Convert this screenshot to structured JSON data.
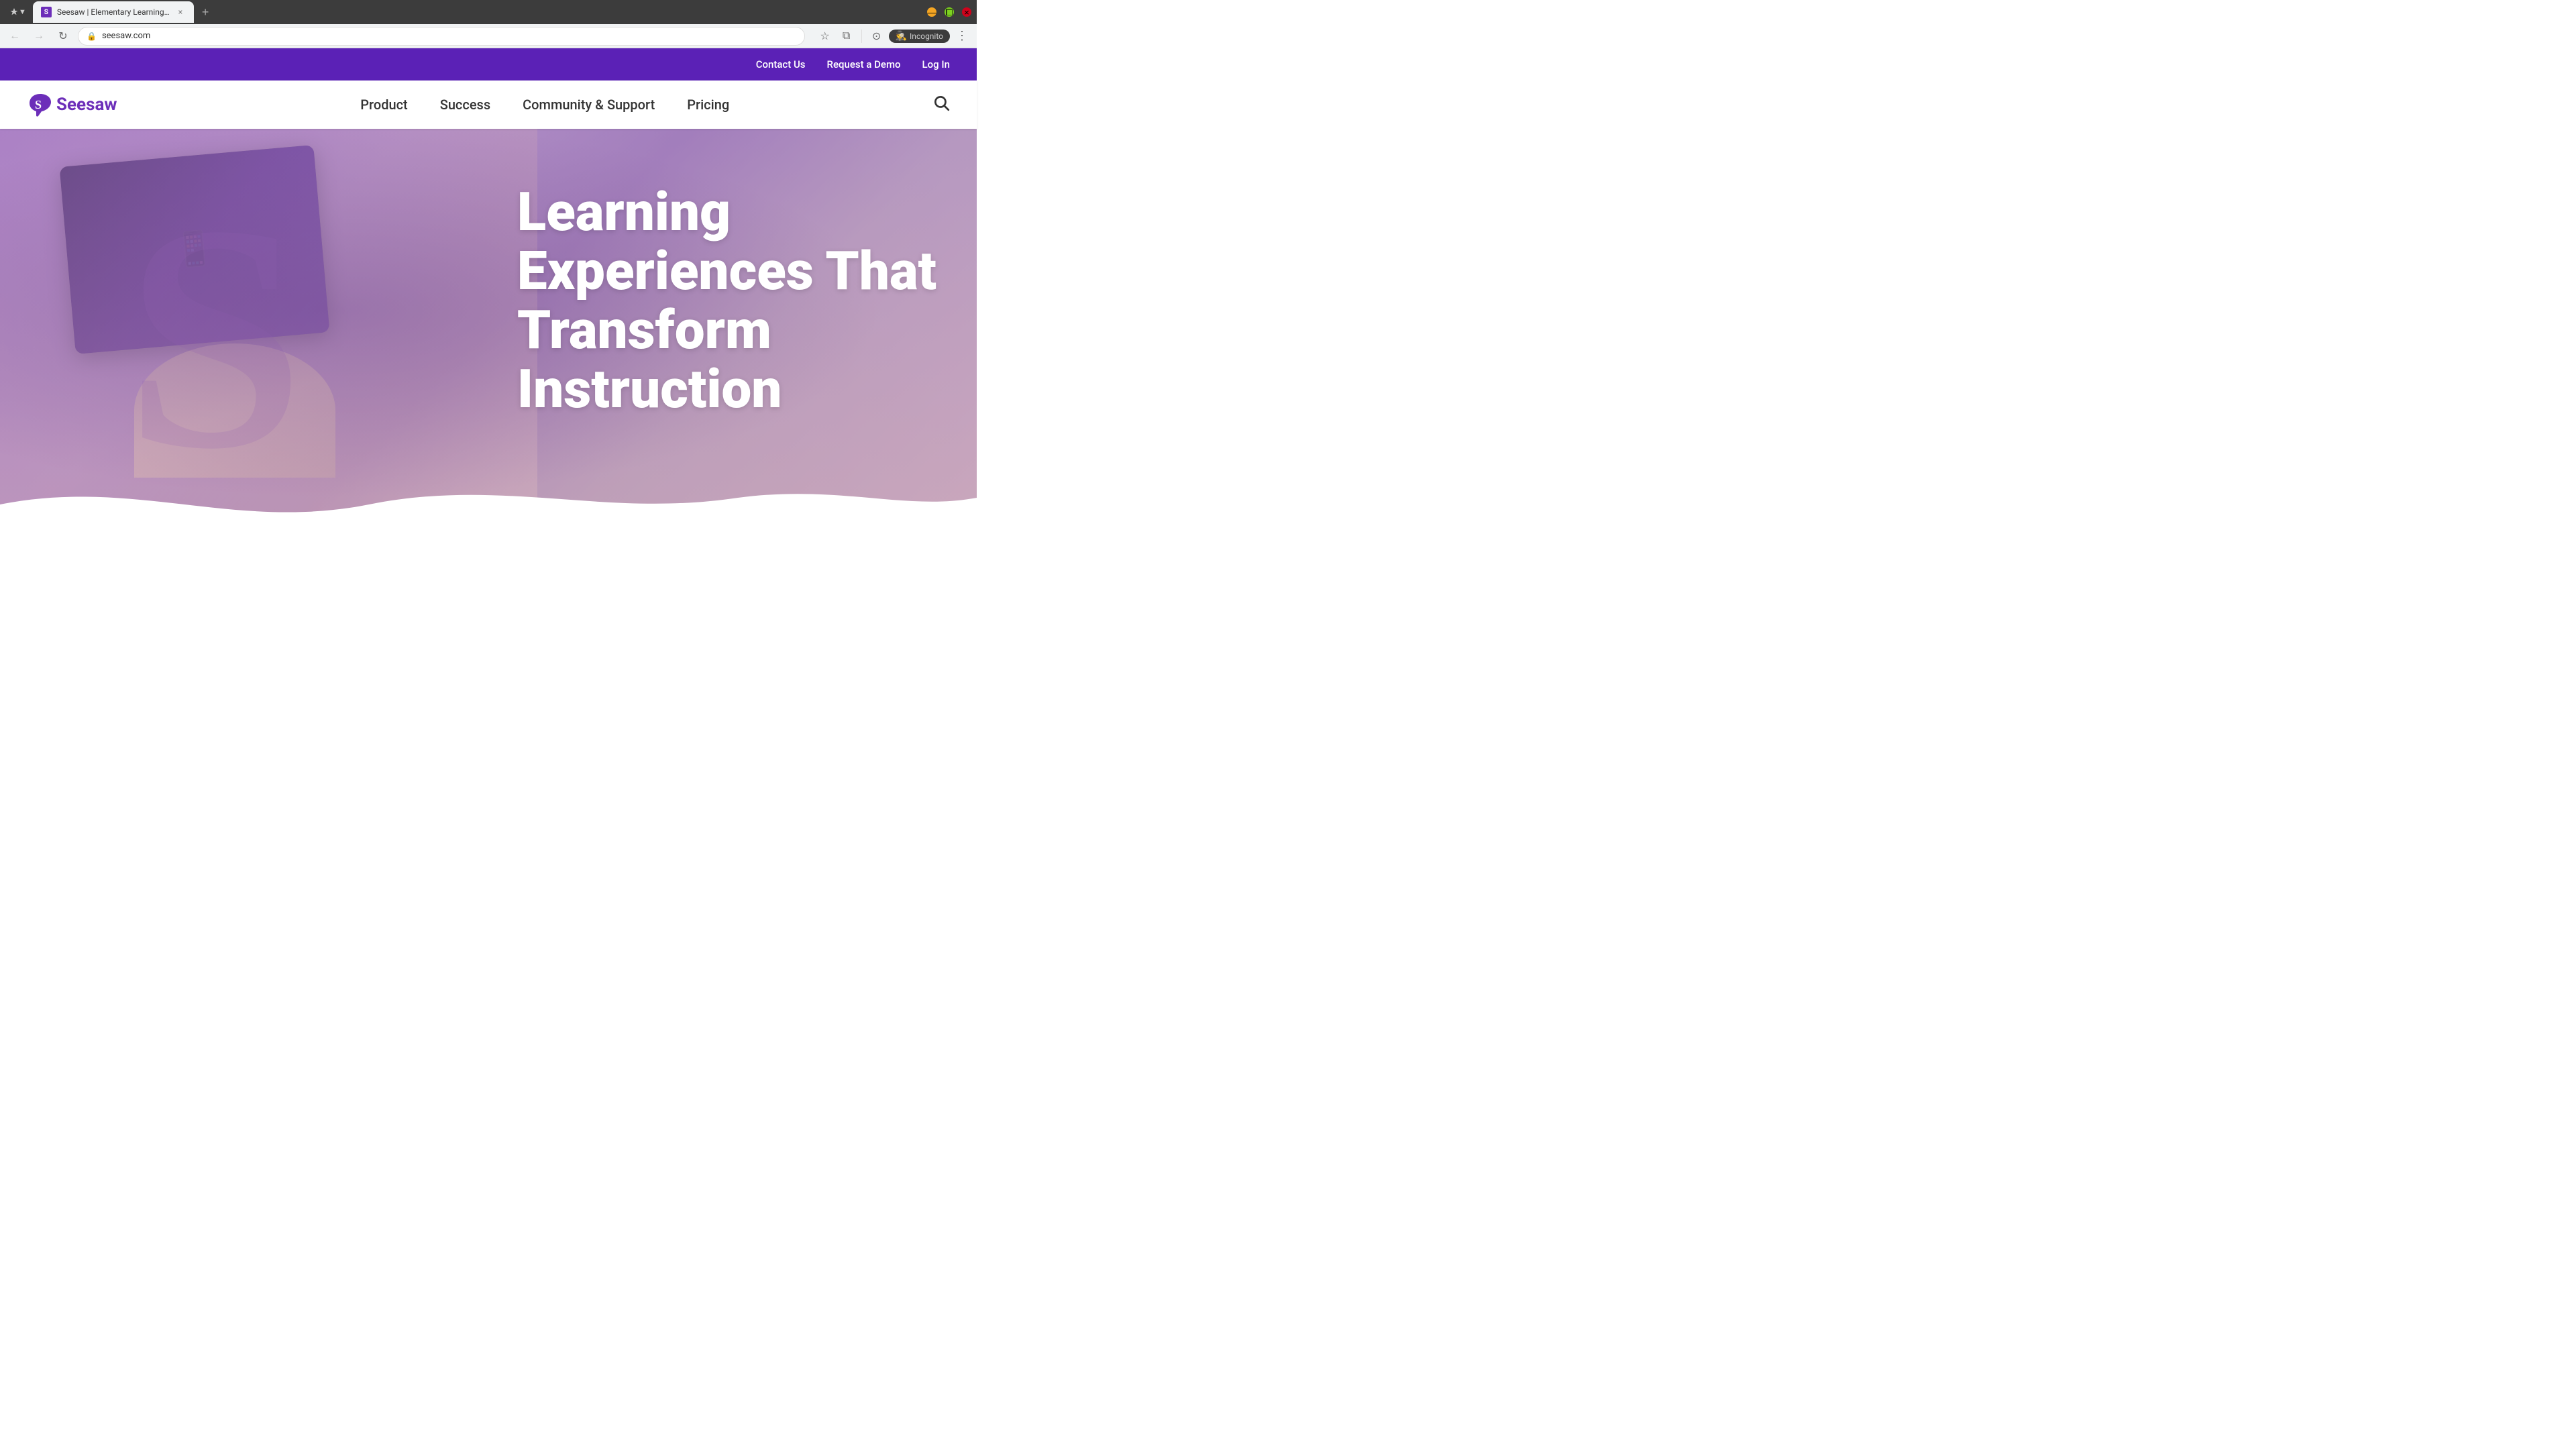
{
  "browser": {
    "tab_favicon": "S",
    "tab_title": "Seesaw | Elementary Learning ...",
    "tab_close_label": "×",
    "new_tab_label": "+",
    "nav_back_label": "←",
    "nav_forward_label": "→",
    "nav_reload_label": "↻",
    "url": "seesaw.com",
    "bookmark_label": "☆",
    "extensions_label": "⧉",
    "profile_label": "⊙",
    "incognito_label": "Incognito",
    "more_label": "⋮",
    "window_controls": {
      "minimize": "—",
      "maximize": "⧠",
      "close": "×"
    }
  },
  "site": {
    "top_bar": {
      "contact_us": "Contact Us",
      "request_demo": "Request a Demo",
      "log_in": "Log In"
    },
    "nav": {
      "logo_text": "Seesaw",
      "product": "Product",
      "success": "Success",
      "community_support": "Community & Support",
      "pricing": "Pricing"
    },
    "hero": {
      "title_line1": "Learning",
      "title_line2": "Experiences That",
      "title_line3": "Transform",
      "title_line4": "Instruction",
      "s_watermark": "S"
    }
  }
}
